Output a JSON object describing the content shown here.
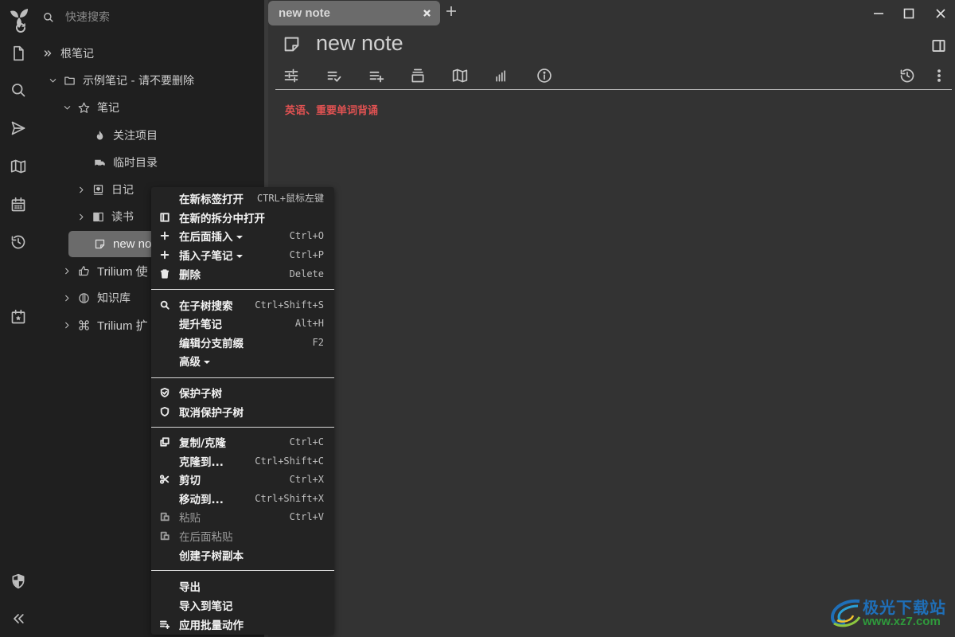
{
  "search": {
    "placeholder": "快速搜索"
  },
  "launcher": {
    "items": [
      {
        "name": "new-note",
        "icon": "file-icon"
      },
      {
        "name": "search",
        "icon": "search-icon"
      },
      {
        "name": "jump-to",
        "icon": "send-icon"
      },
      {
        "name": "note-map",
        "icon": "map-icon"
      },
      {
        "name": "calendar",
        "icon": "calendar-icon"
      },
      {
        "name": "recent-changes",
        "icon": "history-icon"
      },
      {
        "name": "today",
        "icon": "calendar-star-icon"
      },
      {
        "name": "protected-session",
        "icon": "shield-icon"
      },
      {
        "name": "collapse",
        "icon": "double-chevron-left-icon"
      }
    ]
  },
  "tree": {
    "nodes": [
      {
        "label": "根笔记",
        "icon": "double-chevron-right-icon",
        "level": 0
      },
      {
        "label": "示例笔记 - 请不要删除",
        "icon": "folder-icon",
        "expanded": true
      },
      {
        "label": "笔记",
        "icon": "star-icon",
        "expanded": true
      },
      {
        "label": "关注项目",
        "icon": "fire-icon"
      },
      {
        "label": "临时目录",
        "icon": "truck-icon"
      },
      {
        "label": "日记",
        "icon": "diary-icon",
        "expanded": false
      },
      {
        "label": "读书",
        "icon": "book-icon",
        "expanded": false
      },
      {
        "label": "new note",
        "icon": "note-icon",
        "active": true
      },
      {
        "label": "Trilium 使",
        "icon": "thumbs-up-icon",
        "expanded": false
      },
      {
        "label": "知识库",
        "icon": "bulb-icon",
        "expanded": false
      },
      {
        "label": "Trilium 扩",
        "icon": "command-icon",
        "expanded": false
      }
    ]
  },
  "tabs": [
    {
      "label": "new note",
      "active": true
    }
  ],
  "note": {
    "title": "new note",
    "content": "英语、重要单词背诵",
    "content_color": "#e05252"
  },
  "ribbon": {
    "items": [
      "note-properties-icon",
      "promoted-attributes-icon",
      "owned-attributes-icon",
      "inherited-attributes-icon",
      "note-map-icon",
      "similar-notes-icon",
      "note-info-icon"
    ]
  },
  "context_menu": {
    "items": [
      {
        "label": "在新标签打开",
        "shortcut": "CTRL+鼠标左键",
        "icon": ""
      },
      {
        "label": "在新的拆分中打开",
        "shortcut": "",
        "icon": "split-icon"
      },
      {
        "label": "在后面插入",
        "shortcut": "Ctrl+O",
        "icon": "plus-icon",
        "submenu": true
      },
      {
        "label": "插入子笔记",
        "shortcut": "Ctrl+P",
        "icon": "plus-icon",
        "submenu": true
      },
      {
        "label": "删除",
        "shortcut": "Delete",
        "icon": "trash-icon"
      },
      {
        "label": "在子树搜索",
        "shortcut": "Ctrl+Shift+S",
        "icon": "search-icon"
      },
      {
        "label": "提升笔记",
        "shortcut": "Alt+H",
        "icon": ""
      },
      {
        "label": "编辑分支前缀",
        "shortcut": "F2",
        "icon": ""
      },
      {
        "label": "高级",
        "shortcut": "",
        "icon": "",
        "submenu": true
      },
      {
        "label": "保护子树",
        "shortcut": "",
        "icon": "shield-check-icon"
      },
      {
        "label": "取消保护子树",
        "shortcut": "",
        "icon": "shield-icon"
      },
      {
        "label": "复制/克隆",
        "shortcut": "Ctrl+C",
        "icon": "copy-icon"
      },
      {
        "label": "克隆到...",
        "shortcut": "Ctrl+Shift+C",
        "icon": ""
      },
      {
        "label": "剪切",
        "shortcut": "Ctrl+X",
        "icon": "scissors-icon"
      },
      {
        "label": "移动到...",
        "shortcut": "Ctrl+Shift+X",
        "icon": ""
      },
      {
        "label": "粘贴",
        "shortcut": "Ctrl+V",
        "icon": "paste-icon",
        "disabled": true
      },
      {
        "label": "在后面粘贴",
        "shortcut": "",
        "icon": "paste-icon",
        "disabled": true
      },
      {
        "label": "创建子树副本",
        "shortcut": "",
        "icon": ""
      },
      {
        "label": "导出",
        "shortcut": "",
        "icon": ""
      },
      {
        "label": "导入到笔记",
        "shortcut": "",
        "icon": ""
      },
      {
        "label": "应用批量动作",
        "shortcut": "",
        "icon": "list-plus-icon"
      }
    ]
  },
  "watermark": {
    "name": "极光下载站",
    "url": "www.xz7.com"
  }
}
